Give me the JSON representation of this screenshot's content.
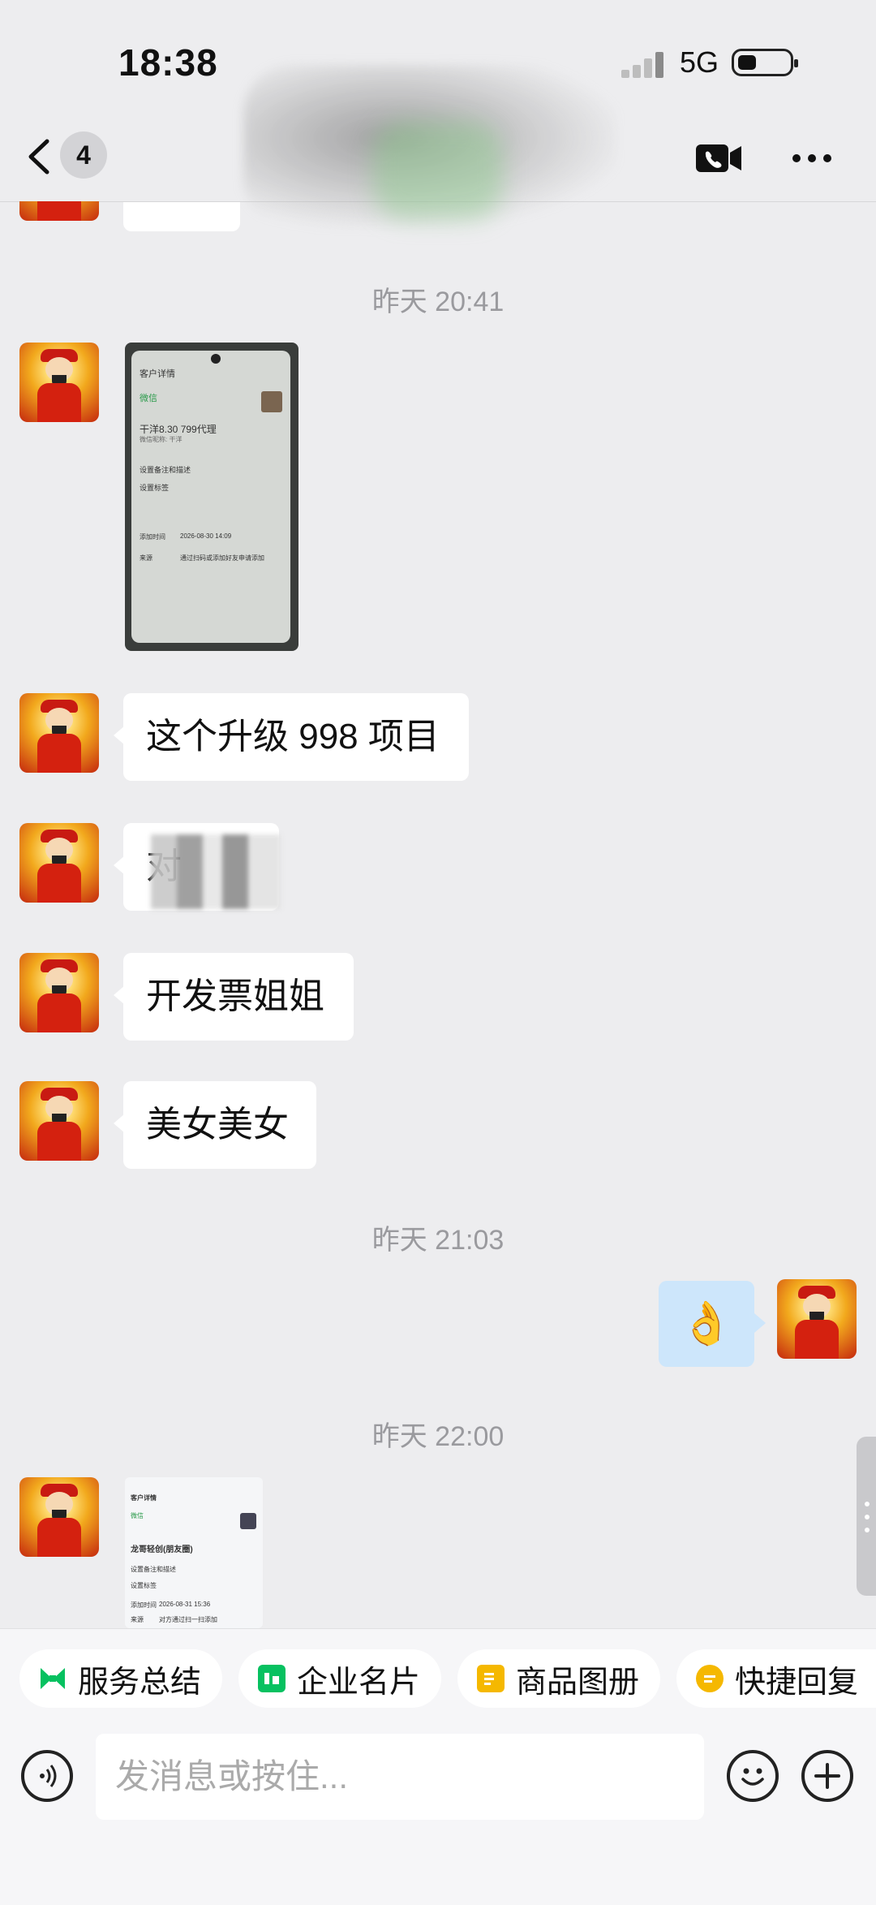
{
  "status": {
    "time": "18:38",
    "network": "5G"
  },
  "header": {
    "unread_count": "4"
  },
  "timestamps": [
    "昨天 20:41",
    "昨天 21:03",
    "昨天 22:00"
  ],
  "messages": {
    "m1": "这个升级 998 项目",
    "m2_visible": "对",
    "m3": "开发票姐姐",
    "m4": "美女美女",
    "m5_emoji": "👌"
  },
  "image1": {
    "title": "客户详情",
    "tag": "微信",
    "name": "干洋8.30 799代理",
    "sub": "微信昵称: 干洋",
    "row1": "设置备注和描述",
    "row2": "设置标签",
    "added_label": "添加时间",
    "added_value": "2026-08-30 14:09",
    "source_label": "来源",
    "source_value": "通过扫码或添加好友申请添加"
  },
  "image2": {
    "title": "客户详情",
    "tag": "微信",
    "name": "龙哥轻创(朋友圈)",
    "row1": "设置备注和描述",
    "row2": "设置标签",
    "added_label": "添加时间",
    "added_value": "2026-08-31 15:36",
    "source_label": "来源",
    "source_value": "对方通过扫一扫添加"
  },
  "quick_actions": [
    "服务总结",
    "企业名片",
    "商品图册",
    "快捷回复"
  ],
  "input": {
    "placeholder": "发消息或按住..."
  },
  "colors": {
    "background": "#ededef",
    "bubble_in": "#ffffff",
    "bubble_out": "#cde6fb",
    "green": "#07c160",
    "yellow": "#f5b800"
  }
}
